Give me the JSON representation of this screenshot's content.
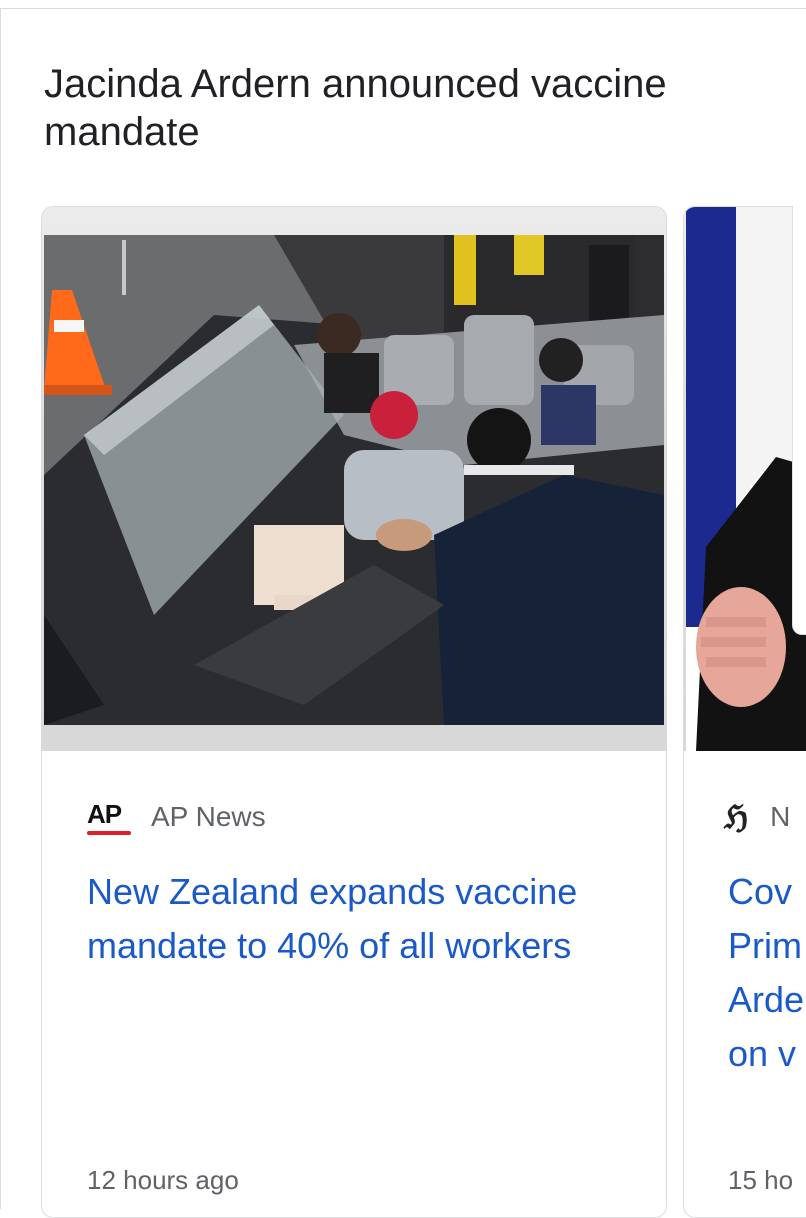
{
  "section": {
    "title_line1": "Jacinda Ardern announced vaccine",
    "title_line2": "mandate"
  },
  "cards": [
    {
      "source": "AP News",
      "source_logo": "AP",
      "headline": "New Zealand expands vaccine mandate to 40% of all workers",
      "time": "12 hours ago",
      "image_icon": "car-vaccination-photo"
    },
    {
      "source": "N",
      "source_logo": "gothic-h-logo",
      "headline_lines": [
        "Cov",
        "Prim",
        "Arde",
        "on v"
      ],
      "time": "15 ho",
      "image_icon": "press-conference-photo"
    }
  ],
  "colors": {
    "headline_link": "#1a59c9",
    "ap_red": "#e01e25",
    "meta_gray": "#5f6368"
  }
}
